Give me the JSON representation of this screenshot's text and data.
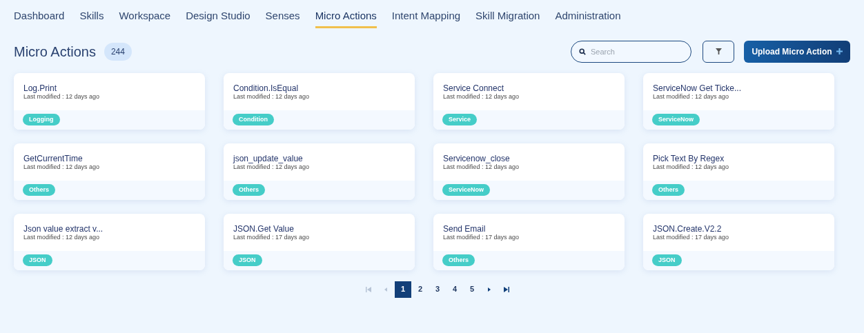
{
  "nav": [
    {
      "label": "Dashboard",
      "selected": false
    },
    {
      "label": "Skills",
      "selected": false
    },
    {
      "label": "Workspace",
      "selected": false
    },
    {
      "label": "Design Studio",
      "selected": false
    },
    {
      "label": "Senses",
      "selected": false
    },
    {
      "label": "Micro Actions",
      "selected": true
    },
    {
      "label": "Intent Mapping",
      "selected": false
    },
    {
      "label": "Skill Migration",
      "selected": false
    },
    {
      "label": "Administration",
      "selected": false
    }
  ],
  "header": {
    "title": "Micro Actions",
    "count": "244",
    "search": {
      "placeholder": "Search"
    },
    "upload_button": "Upload Micro Action"
  },
  "cards": [
    {
      "name": "Log.Print",
      "modified": "Last modified : 12 days ago",
      "tag": "Logging"
    },
    {
      "name": "Condition.IsEqual",
      "modified": "Last modified : 12 days ago",
      "tag": "Condition"
    },
    {
      "name": "Service Connect",
      "modified": "Last modified : 12 days ago",
      "tag": "Service"
    },
    {
      "name": "ServiceNow Get Ticke...",
      "modified": "Last modified : 12 days ago",
      "tag": "ServiceNow"
    },
    {
      "name": "GetCurrentTime",
      "modified": "Last modified : 12 days ago",
      "tag": "Others"
    },
    {
      "name": "json_update_value",
      "modified": "Last modified : 12 days ago",
      "tag": "Others"
    },
    {
      "name": "Servicenow_close",
      "modified": "Last modified : 12 days ago",
      "tag": "ServiceNow"
    },
    {
      "name": "Pick Text By Regex",
      "modified": "Last modified : 12 days ago",
      "tag": "Others"
    },
    {
      "name": "Json value extract v...",
      "modified": "Last modified : 12 days ago",
      "tag": "JSON"
    },
    {
      "name": "JSON.Get Value",
      "modified": "Last modified : 17 days ago",
      "tag": "JSON"
    },
    {
      "name": "Send Email",
      "modified": "Last modified : 17 days ago",
      "tag": "Others"
    },
    {
      "name": "JSON.Create.V2.2",
      "modified": "Last modified : 17 days ago",
      "tag": "JSON"
    }
  ],
  "pagination": {
    "first_disabled": true,
    "prev_disabled": true,
    "next_disabled": false,
    "last_disabled": false,
    "pages": [
      {
        "label": "1",
        "selected": true
      },
      {
        "label": "2",
        "selected": false
      },
      {
        "label": "3",
        "selected": false
      },
      {
        "label": "4",
        "selected": false
      },
      {
        "label": "5",
        "selected": false
      }
    ]
  }
}
